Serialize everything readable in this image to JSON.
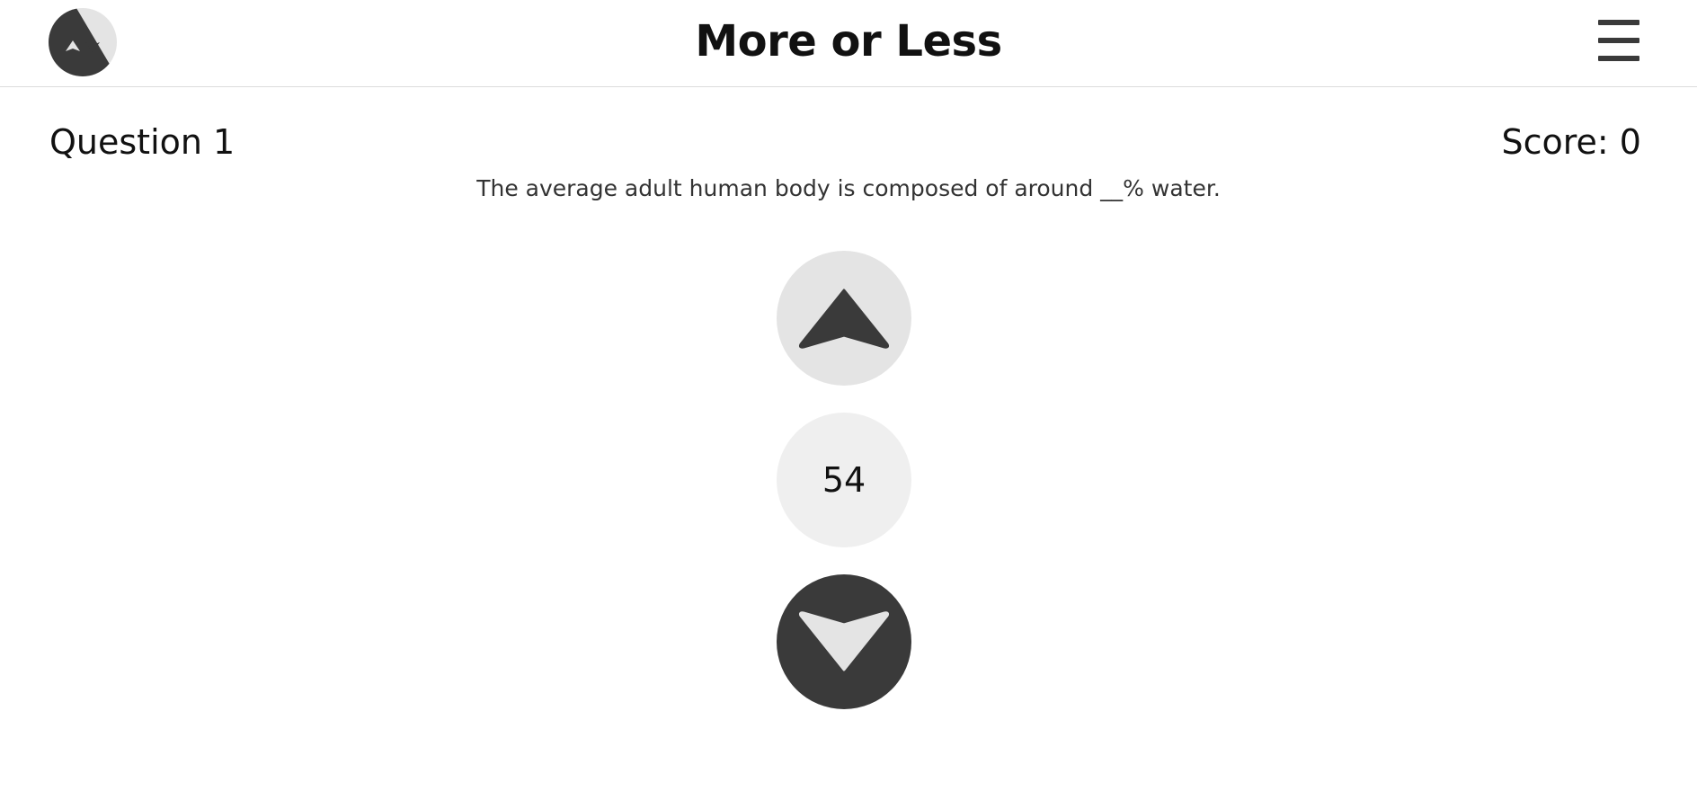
{
  "header": {
    "title": "More or Less",
    "logo_icon": "more-or-less-logo-icon",
    "menu_icon": "hamburger-menu-icon"
  },
  "game": {
    "question_label": "Question 1",
    "score_label": "Score: 0",
    "question_text": "The average adult human body is composed of around __% water.",
    "current_guess": "54",
    "more_button_icon": "arrow-up-icon",
    "less_button_icon": "arrow-down-icon"
  },
  "colors": {
    "dark": "#3a3a3a",
    "light": "#e4e4e4",
    "guess_bg": "#efefef",
    "divider": "#dcdcdc"
  }
}
